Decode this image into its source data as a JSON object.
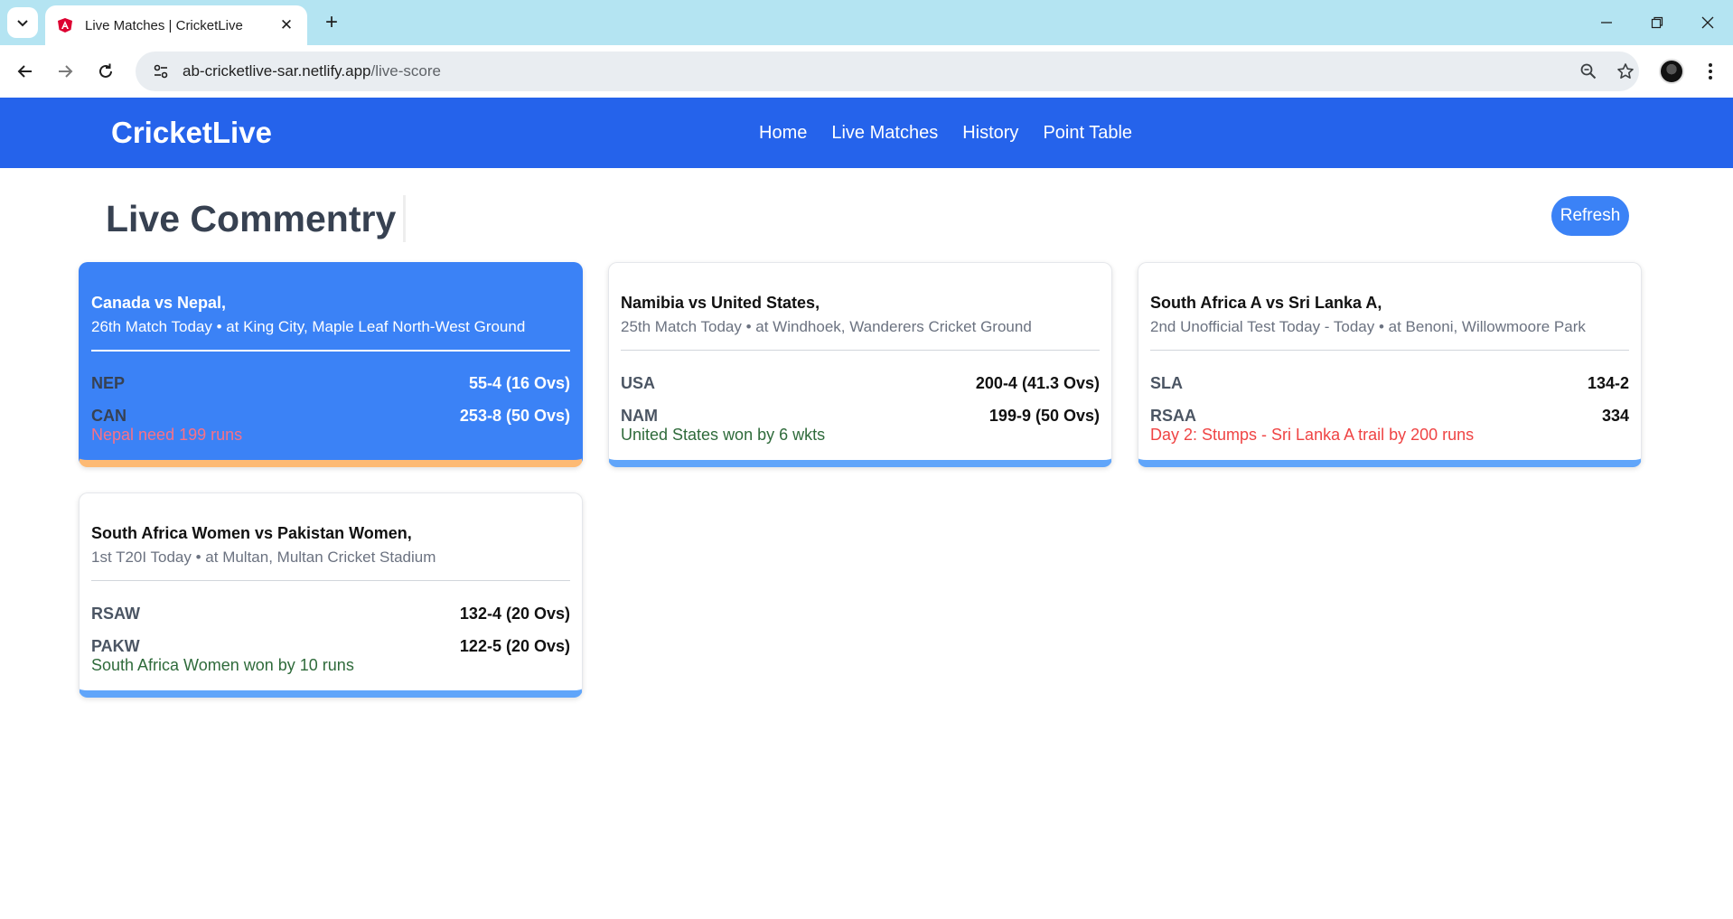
{
  "browser": {
    "tab_title": "Live Matches | CricketLive",
    "url_host": "ab-cricketlive-sar.netlify.app",
    "url_path": "/live-score"
  },
  "site": {
    "brand": "CricketLive",
    "nav": [
      "Home",
      "Live Matches",
      "History",
      "Point Table"
    ]
  },
  "page": {
    "title": "Live Commentry",
    "refresh_label": "Refresh"
  },
  "matches": [
    {
      "title": "Canada vs Nepal,",
      "subtitle": "26th Match Today • at King City, Maple Leaf North-West Ground",
      "team1": "NEP",
      "score1": "55-4 (16 Ovs)",
      "team2": "CAN",
      "score2": "253-8 (50 Ovs)",
      "status": "Nepal need 199 runs",
      "highlighted": true
    },
    {
      "title": "Namibia vs United States,",
      "subtitle": "25th Match Today • at Windhoek, Wanderers Cricket Ground",
      "team1": "USA",
      "score1": "200-4 (41.3 Ovs)",
      "team2": "NAM",
      "score2": "199-9 (50 Ovs)",
      "status": "United States won by 6 wkts",
      "highlighted": false
    },
    {
      "title": "South Africa A vs Sri Lanka A,",
      "subtitle": "2nd Unofficial Test Today - Today • at Benoni, Willowmoore Park",
      "team1": "SLA",
      "score1": "134-2",
      "team2": "RSAA",
      "score2": "334",
      "status": "Day 2: Stumps - Sri Lanka A trail by 200 runs",
      "highlighted": false
    },
    {
      "title": "South Africa Women vs Pakistan Women,",
      "subtitle": "1st T20I Today • at Multan, Multan Cricket Stadium",
      "team1": "RSAW",
      "score1": "132-4 (20 Ovs)",
      "team2": "PAKW",
      "score2": "122-5 (20 Ovs)",
      "status": "South Africa Women won by 10 runs",
      "highlighted": false
    }
  ]
}
